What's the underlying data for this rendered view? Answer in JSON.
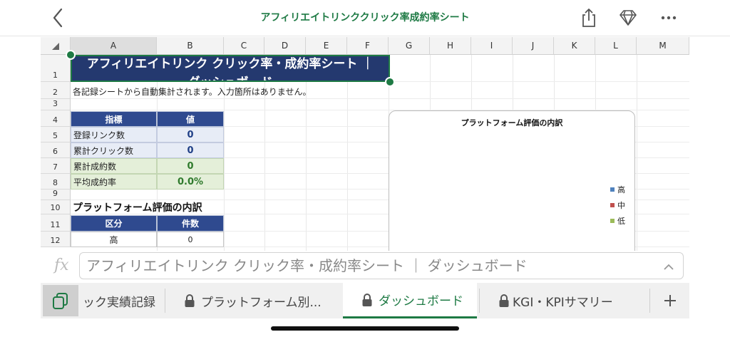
{
  "header": {
    "title": "アフィリエイトリンククリック率成約率シート"
  },
  "grid": {
    "columns": [
      "A",
      "B",
      "C",
      "D",
      "E",
      "F",
      "G",
      "H",
      "I",
      "J",
      "K",
      "L",
      "M"
    ],
    "rows": [
      "1",
      "2",
      "3",
      "4",
      "5",
      "6",
      "7",
      "8",
      "9",
      "10",
      "11",
      "12"
    ],
    "title_banner": "アフィリエイトリンク クリック率・成約率シート ｜ ダッシュボード",
    "note": "各記録シートから自動集計されます。入力箇所はありません。",
    "kpi_table": {
      "headers": [
        "指標",
        "値"
      ],
      "rows": [
        {
          "label": "登録リンク数",
          "value": "0"
        },
        {
          "label": "累計クリック数",
          "value": "0"
        },
        {
          "label": "累計成約数",
          "value": "0"
        },
        {
          "label": "平均成約率",
          "value": "0.0%"
        }
      ]
    },
    "breakdown_title": "プラットフォーム評価の内訳",
    "breakdown_table": {
      "headers": [
        "区分",
        "件数"
      ],
      "rows": [
        {
          "label": "高",
          "value": "0"
        }
      ]
    }
  },
  "chart_data": {
    "type": "bar",
    "title": "プラットフォーム評価の内訳",
    "legend_position": "right",
    "series": [
      {
        "name": "高",
        "color": "#4f81bd",
        "values": []
      },
      {
        "name": "中",
        "color": "#c0504d",
        "values": []
      },
      {
        "name": "低",
        "color": "#9bbb59",
        "values": []
      }
    ]
  },
  "formula_bar": {
    "fx_label": "fx",
    "content": "アフィリエイトリンク クリック率・成約率シート ｜ ダッシュボード"
  },
  "tabs": [
    {
      "label": "ック実績記録"
    },
    {
      "label": "プラットフォーム別..."
    },
    {
      "label": "ダッシュボード"
    },
    {
      "label": "KGI・KPIサマリー"
    }
  ],
  "colors": {
    "accent": "#1e7a44",
    "header_blue": "#2f4a8f"
  }
}
